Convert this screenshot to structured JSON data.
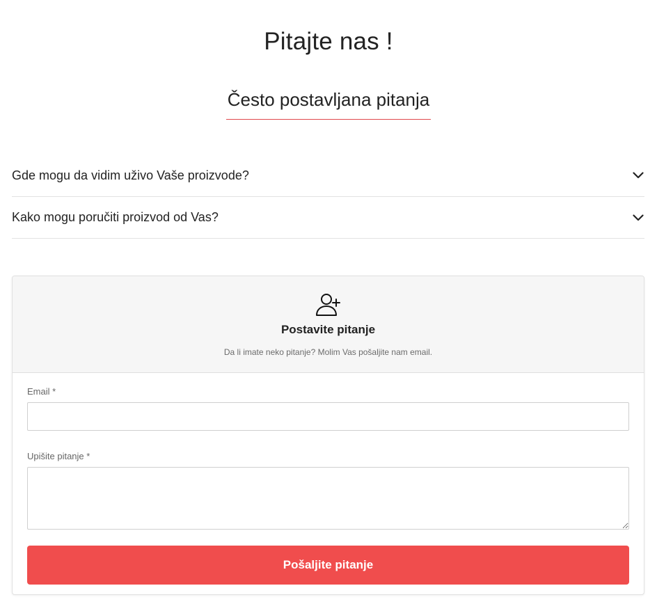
{
  "page": {
    "title": "Pitajte nas !",
    "section_title": "Često postavljana pitanja"
  },
  "faq": {
    "items": [
      {
        "question": "Gde mogu da vidim uživo Vaše proizvode?",
        "icon": "chevron-down-icon"
      },
      {
        "question": "Kako mogu poručiti proizvod od Vas?",
        "icon": "chevron-down-icon"
      }
    ]
  },
  "contact_card": {
    "icon": "user-plus-icon",
    "title": "Postavite pitanje",
    "subtitle": "Da li imate neko pitanje? Molim Vas pošaljite nam email.",
    "email_label": "Email *",
    "email_value": "",
    "email_placeholder": "",
    "question_label": "Upišite pitanje *",
    "question_value": "",
    "question_placeholder": "",
    "submit_label": "Pošaljite pitanje"
  },
  "colors": {
    "accent": "#f04d4d",
    "underline": "#e0474c",
    "card_header_bg": "#f6f6f6"
  }
}
